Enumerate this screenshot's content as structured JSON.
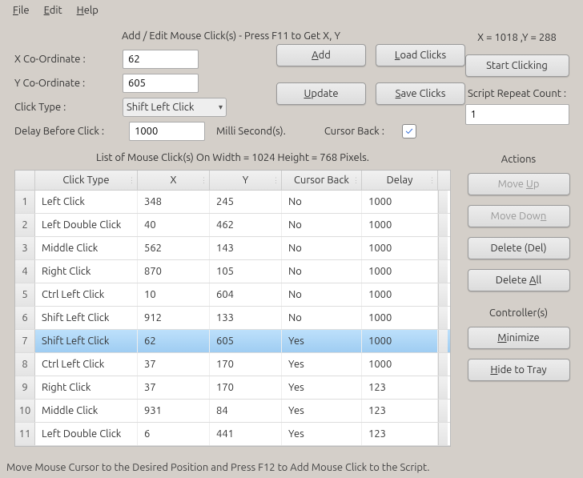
{
  "menu": {
    "file": "File",
    "edit": "Edit",
    "help": "Help"
  },
  "panel": {
    "title": "Add / Edit Mouse Click(s) - Press F11 to Get X, Y",
    "x_label": "X Co-Ordinate :",
    "y_label": "Y Co-Ordinate :",
    "click_type_label": "Click Type :",
    "delay_label": "Delay Before Click :",
    "milli": "Milli Second(s).",
    "cursor_back_label": "Cursor Back :",
    "x_value": "62",
    "y_value": "605",
    "click_type_value": "Shift Left Click",
    "delay_value": "1000",
    "cursor_back_checked": "✓"
  },
  "buttons": {
    "add": "Add",
    "load": "Load Clicks",
    "update": "Update",
    "save": "Save Clicks",
    "start": "Start Clicking"
  },
  "coords_readout": "X = 1018 ,Y = 288",
  "script_repeat": {
    "label": "Script Repeat Count :",
    "value": "1"
  },
  "table": {
    "title": "List of Mouse Click(s) On Width = 1024 Height = 768 Pixels.",
    "headers": {
      "ct": "Click Type",
      "x": "X",
      "y": "Y",
      "cb": "Cursor Back",
      "d": "Delay"
    },
    "rows": [
      {
        "n": "1",
        "ct": "Left Click",
        "x": "348",
        "y": "245",
        "cb": "No",
        "d": "1000"
      },
      {
        "n": "2",
        "ct": "Left Double Click",
        "x": "40",
        "y": "462",
        "cb": "No",
        "d": "1000"
      },
      {
        "n": "3",
        "ct": "Middle Click",
        "x": "562",
        "y": "143",
        "cb": "No",
        "d": "1000"
      },
      {
        "n": "4",
        "ct": "Right Click",
        "x": "870",
        "y": "105",
        "cb": "No",
        "d": "1000"
      },
      {
        "n": "5",
        "ct": "Ctrl Left Click",
        "x": "10",
        "y": "604",
        "cb": "No",
        "d": "1000"
      },
      {
        "n": "6",
        "ct": "Shift Left Click",
        "x": "912",
        "y": "133",
        "cb": "No",
        "d": "1000"
      },
      {
        "n": "7",
        "ct": "Shift Left Click",
        "x": "62",
        "y": "605",
        "cb": "Yes",
        "d": "1000"
      },
      {
        "n": "8",
        "ct": "Ctrl Left Click",
        "x": "37",
        "y": "170",
        "cb": "Yes",
        "d": "1000"
      },
      {
        "n": "9",
        "ct": "Right Click",
        "x": "37",
        "y": "170",
        "cb": "Yes",
        "d": "123"
      },
      {
        "n": "10",
        "ct": "Middle Click",
        "x": "931",
        "y": "84",
        "cb": "Yes",
        "d": "123"
      },
      {
        "n": "11",
        "ct": "Left Double Click",
        "x": "6",
        "y": "441",
        "cb": "Yes",
        "d": "123"
      }
    ],
    "selected_index": 6
  },
  "actions": {
    "title": "Actions",
    "move_up": "Move Up",
    "move_down": "Move Down",
    "delete": "Delete (Del)",
    "delete_all": "Delete All"
  },
  "controllers": {
    "title": "Controller(s)",
    "minimize": "Minimize",
    "hide": "Hide to Tray"
  },
  "status": "Move Mouse Cursor to the Desired Position and Press F12 to Add Mouse Click to the Script."
}
